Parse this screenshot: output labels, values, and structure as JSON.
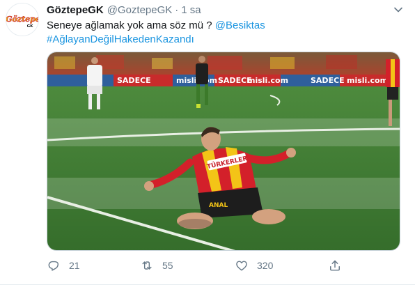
{
  "tweet": {
    "display_name": "GöztepeGK",
    "handle": "@GoztepeGK",
    "separator": "·",
    "time": "1 sa",
    "text_line1": "Seneye ağlamak yok ama söz mü ? ",
    "mention": "@Besiktas",
    "hashtag": "#AğlayanDeğilHakedenKazandı"
  },
  "avatar": {
    "logo_text": "Göztepe",
    "logo_sub": "GK"
  },
  "media": {
    "banner_texts": [
      "SADECE",
      "misli.com",
      "SADECE",
      "misli.com",
      "SADECE",
      "misli.com"
    ],
    "shirt_sponsor": "TÜRKERLER",
    "shorts_text": "ANAL"
  },
  "actions": {
    "reply_count": "21",
    "retweet_count": "55",
    "like_count": "320"
  },
  "colors": {
    "link": "#1b95e0",
    "secondary_text": "#657786",
    "pitch": "#3f7a34",
    "shirt_red": "#d3202a",
    "shirt_yellow": "#f3c417"
  },
  "icons": [
    "caret-down-icon",
    "reply-icon",
    "retweet-icon",
    "like-icon",
    "share-icon"
  ]
}
